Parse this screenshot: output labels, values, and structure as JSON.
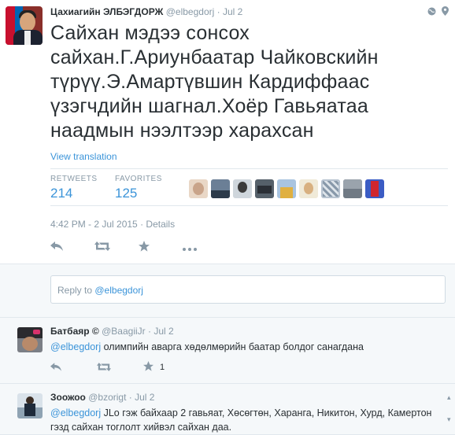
{
  "tweet": {
    "name": "Цахиагийн ЭЛБЭГДОРЖ",
    "handle": "@elbegdorj",
    "dot": "·",
    "time": "Jul 2",
    "text_lines": [
      "Сайхан мэдээ сонсох",
      "сайхан.Г.Ариунбаатар Чайковскийн",
      "түрүү.Э.Амартүвшин Кардиффаас",
      "үзэгчдийн шагнал.Хоёр Гавьяатаа",
      "наадмын нээлтээр харахсан"
    ],
    "view_translation": "View translation",
    "retweets_label": "RETWEETS",
    "retweets": "214",
    "favorites_label": "FAVORITES",
    "favorites": "125",
    "timestamp": "4:42 PM - 2 Jul 2015",
    "details": "Details",
    "header_icons": [
      "globe-icon",
      "location-pin-icon"
    ],
    "actions": [
      "reply-icon",
      "retweet-icon",
      "favorite-icon",
      "more-icon"
    ]
  },
  "reply_box": {
    "prefix": "Reply to",
    "mention": "@elbegdorj"
  },
  "replies": [
    {
      "name": "Батбаяр ©",
      "handle": "@BaagiiJr",
      "dot": "·",
      "time": "Jul 2",
      "mention": "@elbegdorj",
      "text": " олимпийн аварга хөдөлмөрийн баатар болдог санагдана",
      "favorite_count": "1"
    },
    {
      "name": "Зоожоо",
      "handle": "@bzorigt",
      "dot": "·",
      "time": "Jul 2",
      "mention": "@elbegdorj",
      "text": " JLo гэж байхаар 2 гавьяат, Хөсөгтөн, Харанга, Никитон, Хурд, Камертон гэзд сайхан тоглолт хийвэл сайхан даа."
    }
  ],
  "colors": {
    "link": "#3b94d9",
    "muted": "#8899a6",
    "text": "#292f33",
    "bg_alt": "#f5f8fa"
  }
}
